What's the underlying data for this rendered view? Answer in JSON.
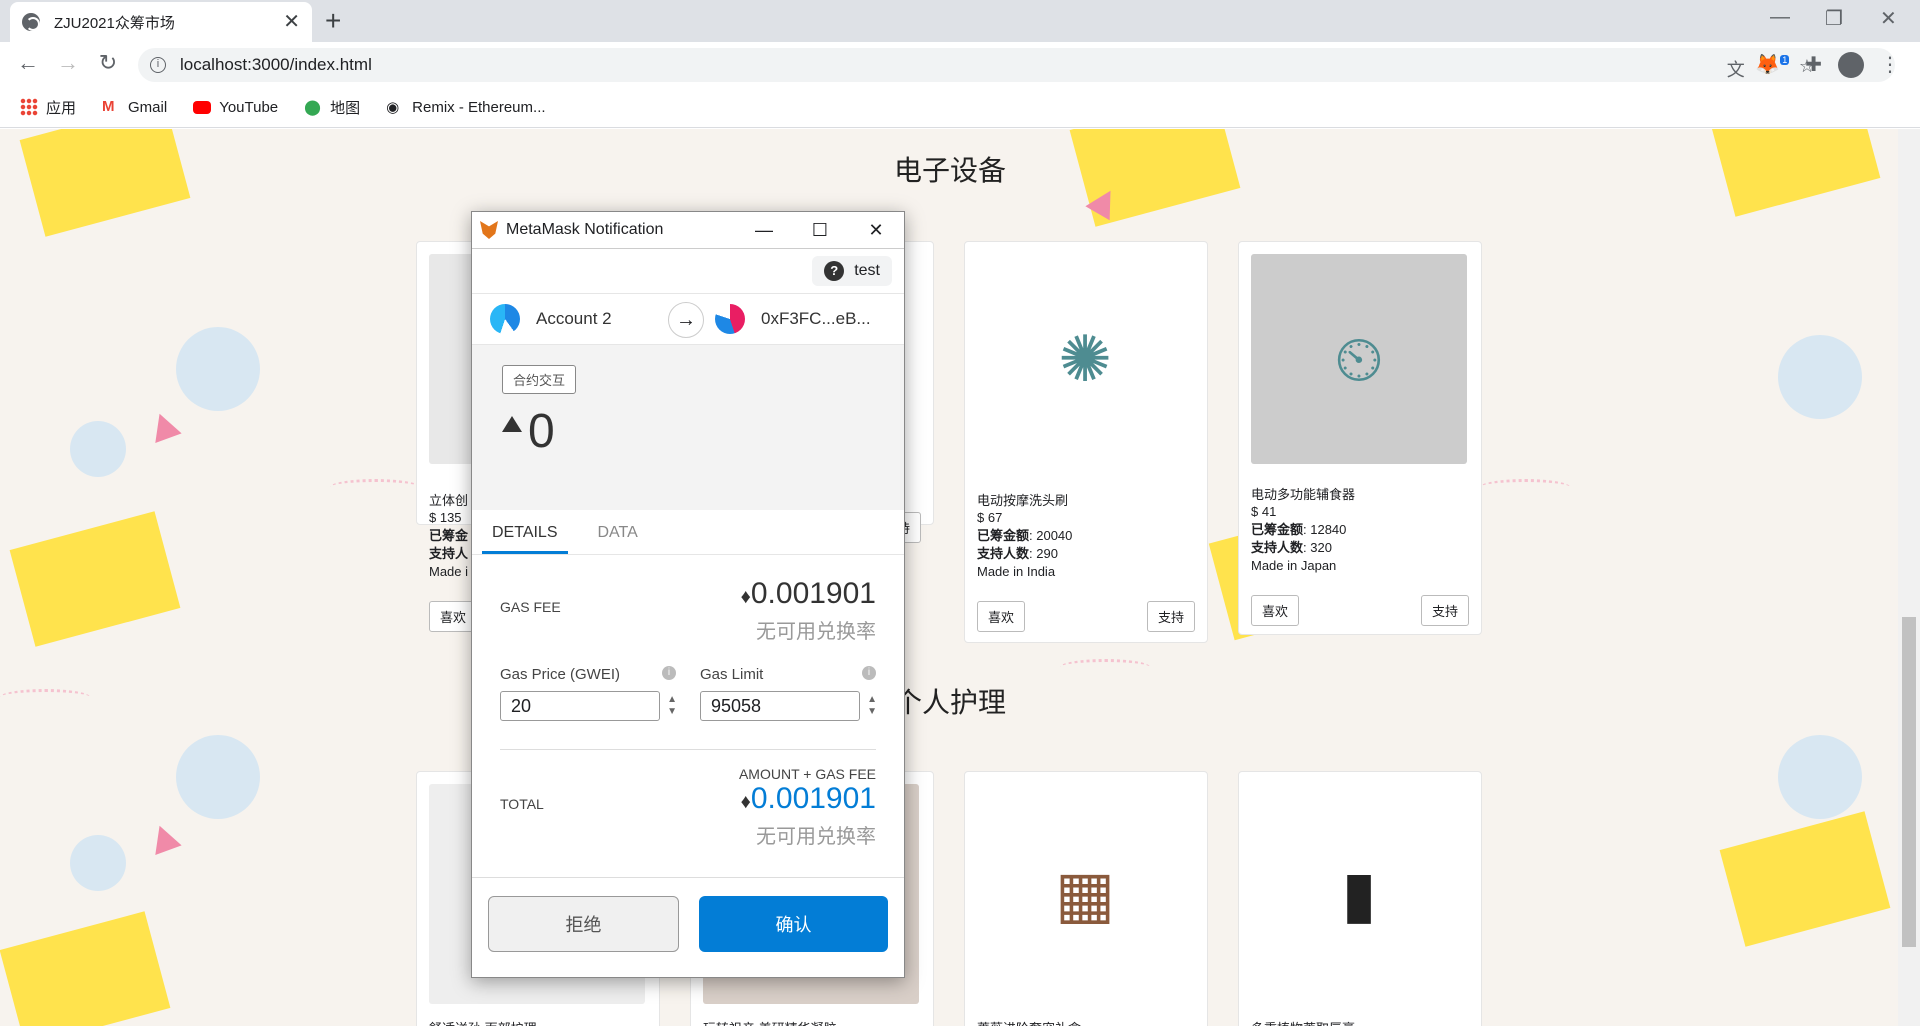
{
  "browser": {
    "tab_title": "ZJU2021众筹市场",
    "url": "localhost:3000/index.html",
    "bookmarks": [
      {
        "label": "应用"
      },
      {
        "label": "Gmail"
      },
      {
        "label": "YouTube"
      },
      {
        "label": "地图"
      },
      {
        "label": "Remix - Ethereum..."
      }
    ],
    "extension_badge": "1"
  },
  "page": {
    "sections": [
      {
        "title": "电子设备",
        "cards": [
          {
            "name": "立体创",
            "price": "$ 135",
            "raised_label": "已筹金",
            "backers_label": "支持人",
            "origin": "Made i",
            "like": "喜欢",
            "support": "支持"
          },
          {
            "name": "",
            "price": "",
            "raised_label": "",
            "backers_label": "",
            "origin": "",
            "like": "",
            "support": "持"
          },
          {
            "name": "电动按摩洗头刷",
            "price": "$ 67",
            "raised_label": "已筹金额",
            "raised": ": 20040",
            "backers_label": "支持人数",
            "backers": ": 290",
            "origin": "Made in India",
            "like": "喜欢",
            "support": "支持"
          },
          {
            "name": "电动多功能辅食器",
            "price": "$ 41",
            "raised_label": "已筹金额",
            "raised": ": 12840",
            "backers_label": "支持人数",
            "backers": ": 320",
            "origin": "Made in Japan",
            "like": "喜欢",
            "support": "支持"
          }
        ]
      },
      {
        "title": "个人护理",
        "cards": [
          {
            "name": "舒适送孙 面部护理"
          },
          {
            "name": "玩转祖亲 美研精华凝胶"
          },
          {
            "name": "蔷薇进阶奢宠礼盒"
          },
          {
            "name": "多重植物萃取唇膏"
          }
        ]
      }
    ]
  },
  "metamask": {
    "window_title": "MetaMask Notification",
    "network": "test",
    "from_account": "Account 2",
    "to_account": "0xF3FC...eB...",
    "tx_type": "合约交互",
    "amount": "0",
    "tabs": [
      "DETAILS",
      "DATA"
    ],
    "gas_fee_label": "GAS FEE",
    "gas_fee": "0.001901",
    "no_rate": "无可用兑换率",
    "gas_price_label": "Gas Price (GWEI)",
    "gas_price": "20",
    "gas_limit_label": "Gas Limit",
    "gas_limit": "95058",
    "amount_gas_label": "AMOUNT + GAS FEE",
    "total_label": "TOTAL",
    "total": "0.001901",
    "reject": "拒绝",
    "confirm": "确认",
    "accent": "#037dd6"
  }
}
